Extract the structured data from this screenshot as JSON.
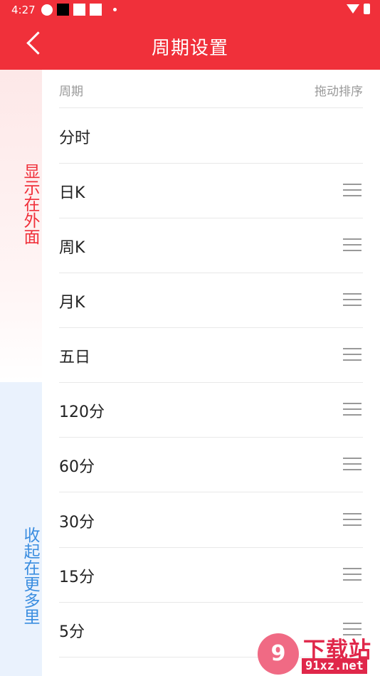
{
  "status_bar": {
    "time": "4:27"
  },
  "header": {
    "title": "周期设置"
  },
  "sections": {
    "shown_label": "显示在外面",
    "hidden_label": "收起在更多里"
  },
  "list_header": {
    "left": "周期",
    "right": "拖动排序"
  },
  "rows": [
    {
      "label": "分时",
      "draggable": false
    },
    {
      "label": "日K",
      "draggable": true
    },
    {
      "label": "周K",
      "draggable": true
    },
    {
      "label": "月K",
      "draggable": true
    },
    {
      "label": "五日",
      "draggable": true
    },
    {
      "label": "120分",
      "draggable": true
    },
    {
      "label": "60分",
      "draggable": true
    },
    {
      "label": "30分",
      "draggable": true
    },
    {
      "label": "15分",
      "draggable": true
    },
    {
      "label": "5分",
      "draggable": true
    }
  ],
  "watermark": {
    "logo_text": "9",
    "title": "下载站",
    "url": "91xz.net"
  },
  "colors": {
    "brand": "#f0303a",
    "shown_section": "#f0303a",
    "hidden_section": "#3a8de0"
  }
}
